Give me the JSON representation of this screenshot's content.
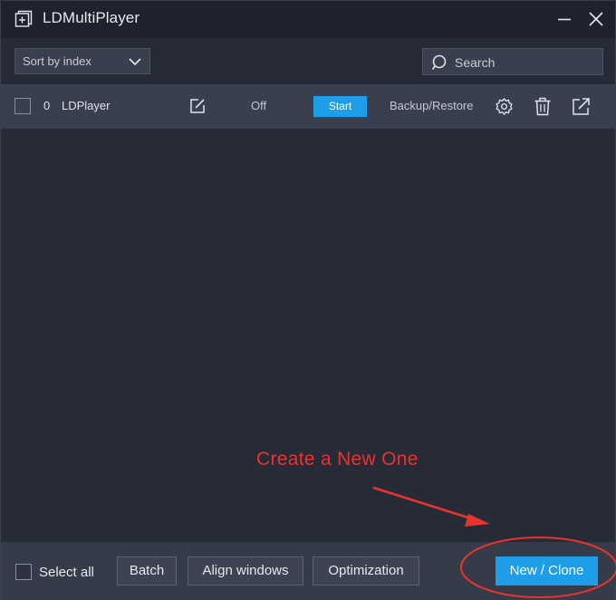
{
  "window": {
    "title": "LDMultiPlayer"
  },
  "toolbar": {
    "sort": {
      "selected": "Sort by index"
    },
    "search": {
      "placeholder": "Search"
    }
  },
  "players": [
    {
      "index": "0",
      "name": "LDPlayer",
      "status": "Off",
      "start_label": "Start",
      "backup_label": "Backup/Restore"
    }
  ],
  "annotation": {
    "text": "Create a New One",
    "color": "#e8342e"
  },
  "footer": {
    "select_all_label": "Select all",
    "batch_label": "Batch",
    "align_label": "Align windows",
    "optimization_label": "Optimization",
    "new_clone_label": "New / Clone"
  },
  "colors": {
    "accent": "#1e9ee8",
    "background": "#272b38",
    "titlebar": "#1f222c"
  },
  "icons": [
    "app-logo-icon",
    "minimize-icon",
    "close-icon",
    "chevron-down-icon",
    "search-icon",
    "edit-icon",
    "gear-icon",
    "trash-icon",
    "share-icon"
  ]
}
